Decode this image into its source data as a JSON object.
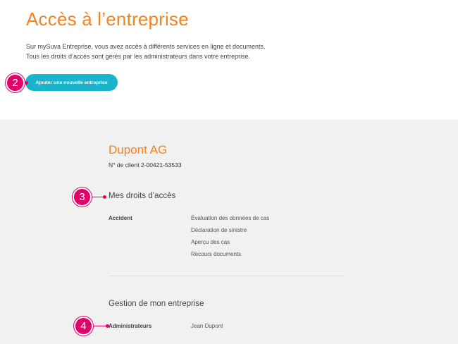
{
  "header": {
    "title": "Accès à l’entreprise",
    "intro_line1": "Sur mySuva Entreprise, vous avez accès à différents services en ligne et documents.",
    "intro_line2": "Tous les droits d’accès sont gérés par les administrateurs dans votre entreprise.",
    "add_button_label": "Ajouter une nouvelle entreprise"
  },
  "markers": [
    "2",
    "3",
    "4"
  ],
  "company": {
    "name": "Dupont AG",
    "client_number": "N° de client 2-00421-53533",
    "rights": {
      "title": "Mes droits d’accès",
      "category": "Accident",
      "items": [
        "Évaluation des données de cas",
        "Déclaration de sinistre",
        "Aperçu des cas",
        "Recours documents"
      ]
    },
    "management": {
      "title": "Gestion de mon entreprise",
      "admin_label": "Administrateurs",
      "admin_value": "Jean Dupont"
    }
  },
  "colors": {
    "accent_orange": "#f58220",
    "button_cyan": "#1ab3cc",
    "marker_pink": "#e2006a",
    "panel_gray": "#f1f1f1"
  }
}
